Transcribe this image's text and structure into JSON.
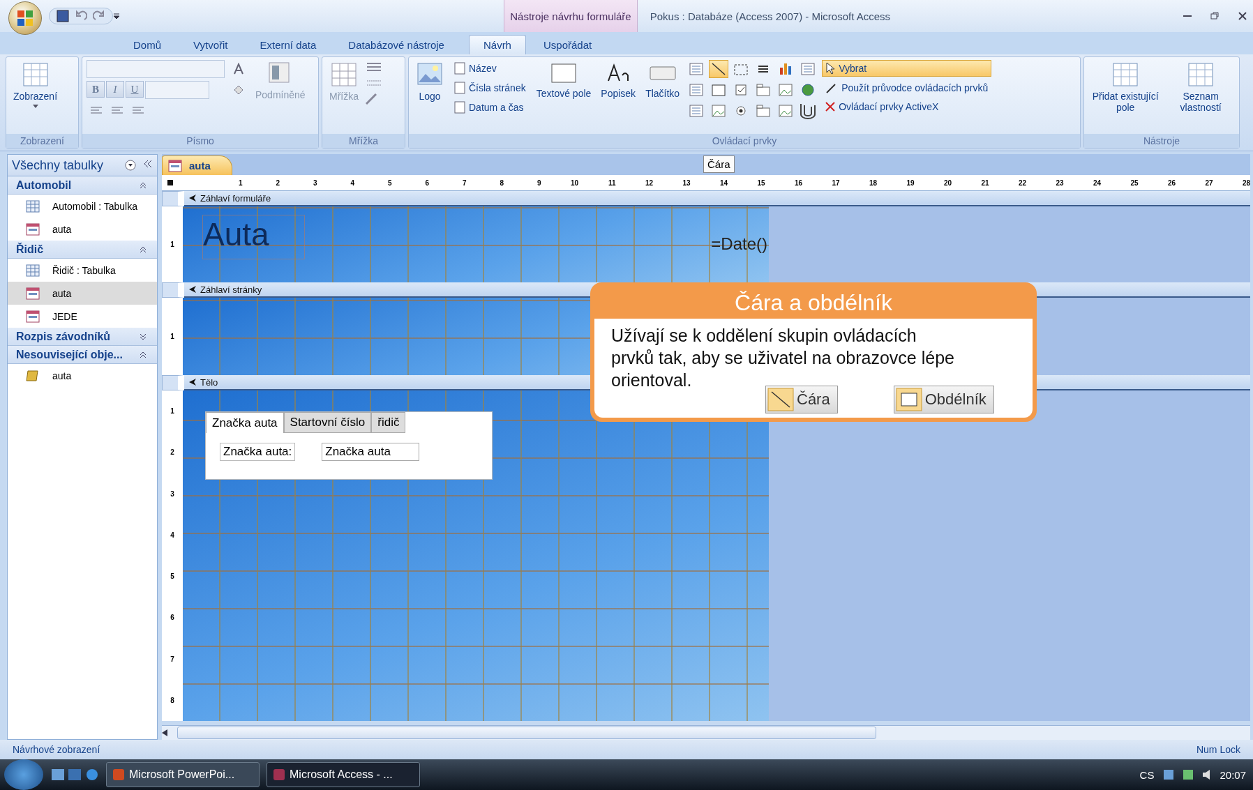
{
  "window": {
    "title": "Pokus : Databáze (Access 2007) - Microsoft Access",
    "context_tab": "Nástroje návrhu formuláře"
  },
  "ribbon_tabs": [
    {
      "label": "Domů",
      "selected": false
    },
    {
      "label": "Vytvořit",
      "selected": false
    },
    {
      "label": "Externí data",
      "selected": false
    },
    {
      "label": "Databázové nástroje",
      "selected": false
    },
    {
      "label": "Návrh",
      "selected": true
    },
    {
      "label": "Uspořádat",
      "selected": false
    }
  ],
  "ribbon_groups": [
    {
      "kind": "view",
      "title": "Zobrazení",
      "buttons": [
        "Zobrazení"
      ]
    },
    {
      "kind": "font",
      "title": "Písmo",
      "format": [
        "B",
        "I",
        "U"
      ],
      "buttons": [
        "Podmíněné"
      ]
    },
    {
      "kind": "grid",
      "title": "Mřížka",
      "buttons": [
        "Mřížka"
      ]
    },
    {
      "kind": "controls",
      "title": "Ovládací prvky",
      "logo": "Logo",
      "small": [
        "Název",
        "Čísla stránek",
        "Datum a čas"
      ],
      "large": [
        "Textové pole",
        "Popisek",
        "Tlačítko"
      ],
      "tools": [
        {
          "kind": "list",
          "selected": false
        },
        {
          "kind": "line",
          "selected": true
        },
        {
          "kind": "frame",
          "selected": false
        },
        {
          "kind": "break",
          "selected": false
        },
        {
          "kind": "chart",
          "selected": false
        },
        {
          "kind": "list",
          "selected": false
        },
        {
          "kind": "list",
          "selected": false
        },
        {
          "kind": "rect",
          "selected": false
        },
        {
          "kind": "check",
          "selected": false
        },
        {
          "kind": "tab",
          "selected": false
        },
        {
          "kind": "image",
          "selected": false
        },
        {
          "kind": "globe",
          "selected": false
        },
        {
          "kind": "list",
          "selected": false
        },
        {
          "kind": "image",
          "selected": false
        },
        {
          "kind": "radio",
          "selected": false
        },
        {
          "kind": "tab",
          "selected": false
        },
        {
          "kind": "image",
          "selected": false
        },
        {
          "kind": "clip",
          "selected": false
        }
      ],
      "select": {
        "label": "Vybrat",
        "selected": true
      },
      "wizard": "Použít průvodce ovládacích prvků",
      "activex": "Ovládací prvky ActiveX"
    },
    {
      "kind": "tools",
      "title": "Nástroje",
      "buttons": [
        "Přidat existující pole",
        "Seznam vlastností"
      ]
    }
  ],
  "sidebar": {
    "title": "Všechny tabulky",
    "groups": [
      {
        "label": "Automobil",
        "expanded": true,
        "items": [
          {
            "kind": "table",
            "label": "Automobil : Tabulka",
            "selected": false
          },
          {
            "kind": "form",
            "label": "auta",
            "selected": false
          }
        ]
      },
      {
        "label": "Řidič",
        "expanded": true,
        "items": [
          {
            "kind": "table",
            "label": "Řidič : Tabulka",
            "selected": false
          },
          {
            "kind": "form",
            "label": "auta",
            "selected": true
          },
          {
            "kind": "form",
            "label": "JEDE",
            "selected": false
          }
        ]
      },
      {
        "label": "Rozpis závodníků",
        "expanded": false
      },
      {
        "label": "Nesouvisející obje...",
        "expanded": true,
        "items": [
          {
            "kind": "macro",
            "label": "auta",
            "selected": false
          }
        ]
      }
    ]
  },
  "document_tabs": [
    {
      "label": "auta",
      "selected": true
    }
  ],
  "tooltip": "Čára",
  "ruler": [
    "1",
    "2",
    "3",
    "4",
    "5",
    "6",
    "7",
    "8",
    "9",
    "10",
    "11",
    "12",
    "13",
    "14",
    "15",
    "16",
    "17",
    "18",
    "19",
    "20",
    "21",
    "22",
    "23",
    "24",
    "25",
    "26",
    "27",
    "28"
  ],
  "sections": [
    {
      "kind": "form_header",
      "title": "Záhlaví formuláře",
      "ruler": [
        "1"
      ],
      "label": "Auta",
      "expression": "=Date()"
    },
    {
      "kind": "page_header",
      "title": "Záhlaví stránky",
      "ruler": [
        "1"
      ]
    },
    {
      "kind": "detail",
      "title": "Tělo",
      "ruler": [
        "1",
        "2",
        "3",
        "4",
        "5",
        "6",
        "7",
        "8"
      ],
      "tabs": [
        {
          "label": "Značka auta",
          "selected": true
        },
        {
          "label": "Startovní číslo",
          "selected": false
        },
        {
          "label": "řidič",
          "selected": false
        }
      ],
      "field_label": "Značka auta:",
      "field_value": "Značka auta"
    }
  ],
  "callout": {
    "title": "Čára a obdélník",
    "text": "Užívají se k oddělení skupin ovládacích prvků tak, aby se uživatel na obrazovce lépe orientoval.",
    "buttons": [
      {
        "kind": "line",
        "label": "Čára"
      },
      {
        "kind": "rect",
        "label": "Obdélník"
      }
    ]
  },
  "status_bar": {
    "left": "Návrhové zobrazení",
    "right": "Num Lock"
  },
  "taskbar": {
    "tasks": [
      {
        "kind": "ppt",
        "label": "Microsoft PowerPoi...",
        "selected": false
      },
      {
        "kind": "access",
        "label": "Microsoft Access - ...",
        "selected": true
      }
    ],
    "language": "CS",
    "time": "20:07"
  }
}
